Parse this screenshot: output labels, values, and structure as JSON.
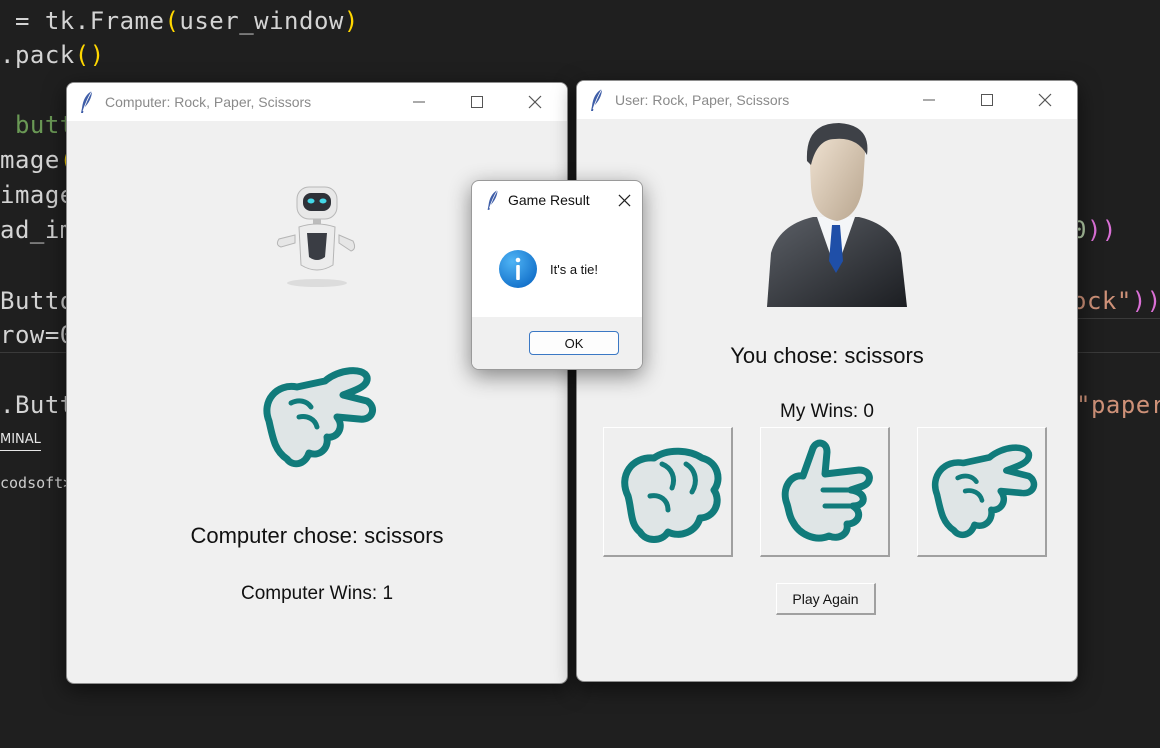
{
  "editor": {
    "lines": [
      {
        "seg": [
          {
            "t": " = tk.Frame",
            "c": "tok-kw"
          },
          {
            "t": "(",
            "c": "tok-paren"
          },
          {
            "t": "user_window",
            "c": "tok-kw"
          },
          {
            "t": ")",
            "c": "tok-paren"
          }
        ]
      },
      {
        "seg": [
          {
            "t": ".pack",
            "c": "tok-kw"
          },
          {
            "t": "()",
            "c": "tok-paren"
          }
        ]
      },
      {
        "seg": [
          {
            "t": " butt",
            "c": "tok-green"
          }
        ]
      },
      {
        "seg": [
          {
            "t": "mage",
            "c": "tok-kw"
          },
          {
            "t": "(",
            "c": "tok-paren"
          }
        ]
      },
      {
        "seg": [
          {
            "t": "image",
            "c": "tok-kw"
          }
        ]
      },
      {
        "seg": [
          {
            "t": "ad_im",
            "c": "tok-kw"
          }
        ]
      },
      {
        "seg": [
          {
            "t": "Butto",
            "c": "tok-kw"
          }
        ]
      },
      {
        "seg": [
          {
            "t": "row=0",
            "c": "tok-kw"
          }
        ]
      },
      {
        "seg": [
          {
            "t": ".Butt",
            "c": "tok-kw"
          }
        ]
      }
    ],
    "right_fragments": [
      {
        "seg": [
          {
            "t": "0",
            "c": "tok-num"
          },
          {
            "t": "))",
            "c": "tok-paren2"
          }
        ]
      },
      {
        "seg": [
          {
            "t": "ock\"",
            "c": "tok-str"
          },
          {
            "t": "))",
            "c": "tok-paren2"
          }
        ]
      },
      {
        "seg": [
          {
            "t": "\"paper",
            "c": "tok-str"
          }
        ]
      }
    ],
    "terminal_tab": "MINAL",
    "terminal_prompt": "codsoft>"
  },
  "computer_window": {
    "title": "Computer: Rock, Paper, Scissors",
    "choice_text": "Computer chose: scissors",
    "wins_text": "Computer Wins: 1",
    "robot_icon": "robot-icon",
    "choice_icon": "scissors-hand-icon"
  },
  "user_window": {
    "title": "User: Rock, Paper, Scissors",
    "choice_text": "You chose: scissors",
    "wins_text": "My Wins: 0",
    "avatar_icon": "businessman-avatar-icon",
    "buttons": [
      {
        "name": "rock",
        "icon": "rock-fist-icon"
      },
      {
        "name": "paper",
        "icon": "paper-hand-icon"
      },
      {
        "name": "scissors",
        "icon": "scissors-hand-icon"
      }
    ],
    "play_again_label": "Play Again"
  },
  "dialog": {
    "title": "Game Result",
    "message": "It's a tie!",
    "ok_label": "OK"
  },
  "colors": {
    "hand_stroke": "#117b7b",
    "info_blue": "#1a7fd6",
    "editor_bg": "#1f1f1f"
  }
}
